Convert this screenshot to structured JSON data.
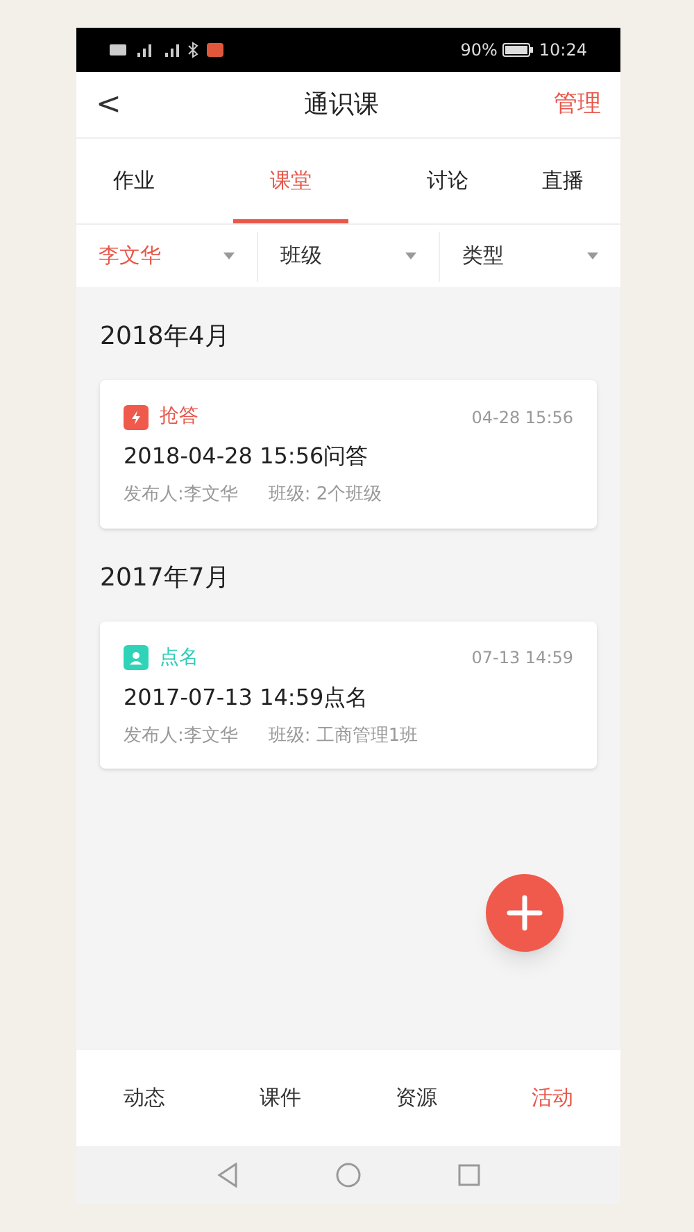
{
  "status_bar": {
    "battery": "90%",
    "time": "10:24"
  },
  "header": {
    "back": "<",
    "title": "通识课",
    "action": "管理"
  },
  "tabs": [
    {
      "label": "作业",
      "selected": false
    },
    {
      "label": "课堂",
      "selected": true
    },
    {
      "label": "讨论",
      "selected": false
    },
    {
      "label": "直播",
      "selected": false
    }
  ],
  "filters": [
    {
      "label": "李文华",
      "selected": true
    },
    {
      "label": "班级",
      "selected": false
    },
    {
      "label": "类型",
      "selected": false
    }
  ],
  "groups": [
    {
      "month": "2018年4月",
      "activities": [
        {
          "kind": "quick_answer",
          "type_label": "抢答",
          "time": "04-28 15:56",
          "title": "2018-04-28 15:56问答",
          "publisher": "发布人:李文华",
          "class": "班级: 2个班级"
        }
      ]
    },
    {
      "month": "2017年7月",
      "activities": [
        {
          "kind": "roll_call",
          "type_label": "点名",
          "time": "07-13 14:59",
          "title": "2017-07-13 14:59点名",
          "publisher": "发布人:李文华",
          "class": "班级: 工商管理1班"
        }
      ]
    }
  ],
  "bottom_tabs": [
    {
      "label": "动态",
      "selected": false
    },
    {
      "label": "课件",
      "selected": false
    },
    {
      "label": "资源",
      "selected": false
    },
    {
      "label": "活动",
      "selected": true
    }
  ]
}
